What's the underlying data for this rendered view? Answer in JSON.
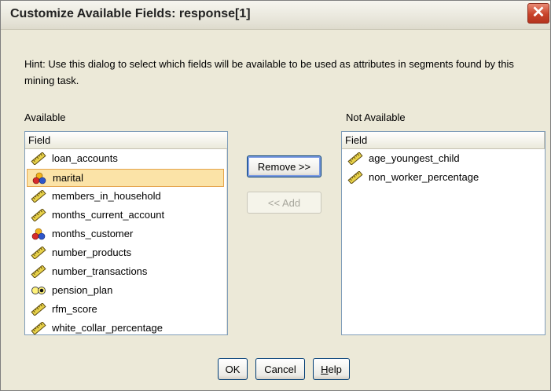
{
  "window": {
    "title": "Customize Available Fields: response[1]",
    "close_glyph": "✕"
  },
  "hint": "Hint: Use this dialog to select which fields will be available to be used as attributes in segments found by this mining task.",
  "available": {
    "label": "Available",
    "column_header": "Field",
    "selected_item": "marital",
    "items": [
      {
        "name": "loan_accounts",
        "icon": "ruler-icon"
      },
      {
        "name": "marital",
        "icon": "nominal-icon"
      },
      {
        "name": "members_in_household",
        "icon": "ruler-icon"
      },
      {
        "name": "months_current_account",
        "icon": "ruler-icon"
      },
      {
        "name": "months_customer",
        "icon": "nominal-icon"
      },
      {
        "name": "number_products",
        "icon": "ruler-icon"
      },
      {
        "name": "number_transactions",
        "icon": "ruler-icon"
      },
      {
        "name": "pension_plan",
        "icon": "flag-icon"
      },
      {
        "name": "rfm_score",
        "icon": "ruler-icon"
      },
      {
        "name": "white_collar_percentage",
        "icon": "ruler-icon"
      }
    ]
  },
  "not_available": {
    "label": "Not Available",
    "column_header": "Field",
    "items": [
      {
        "name": "age_youngest_child",
        "icon": "ruler-icon"
      },
      {
        "name": "non_worker_percentage",
        "icon": "ruler-icon"
      }
    ]
  },
  "buttons": {
    "remove": "Remove >>",
    "add": "<< Add",
    "ok": "OK",
    "cancel": "Cancel",
    "help": "Help"
  },
  "colors": {
    "dialog_bg": "#ece9d8",
    "selection_bg": "#fbe3a7",
    "selection_border": "#e5a44b",
    "list_border": "#7f9db9"
  }
}
